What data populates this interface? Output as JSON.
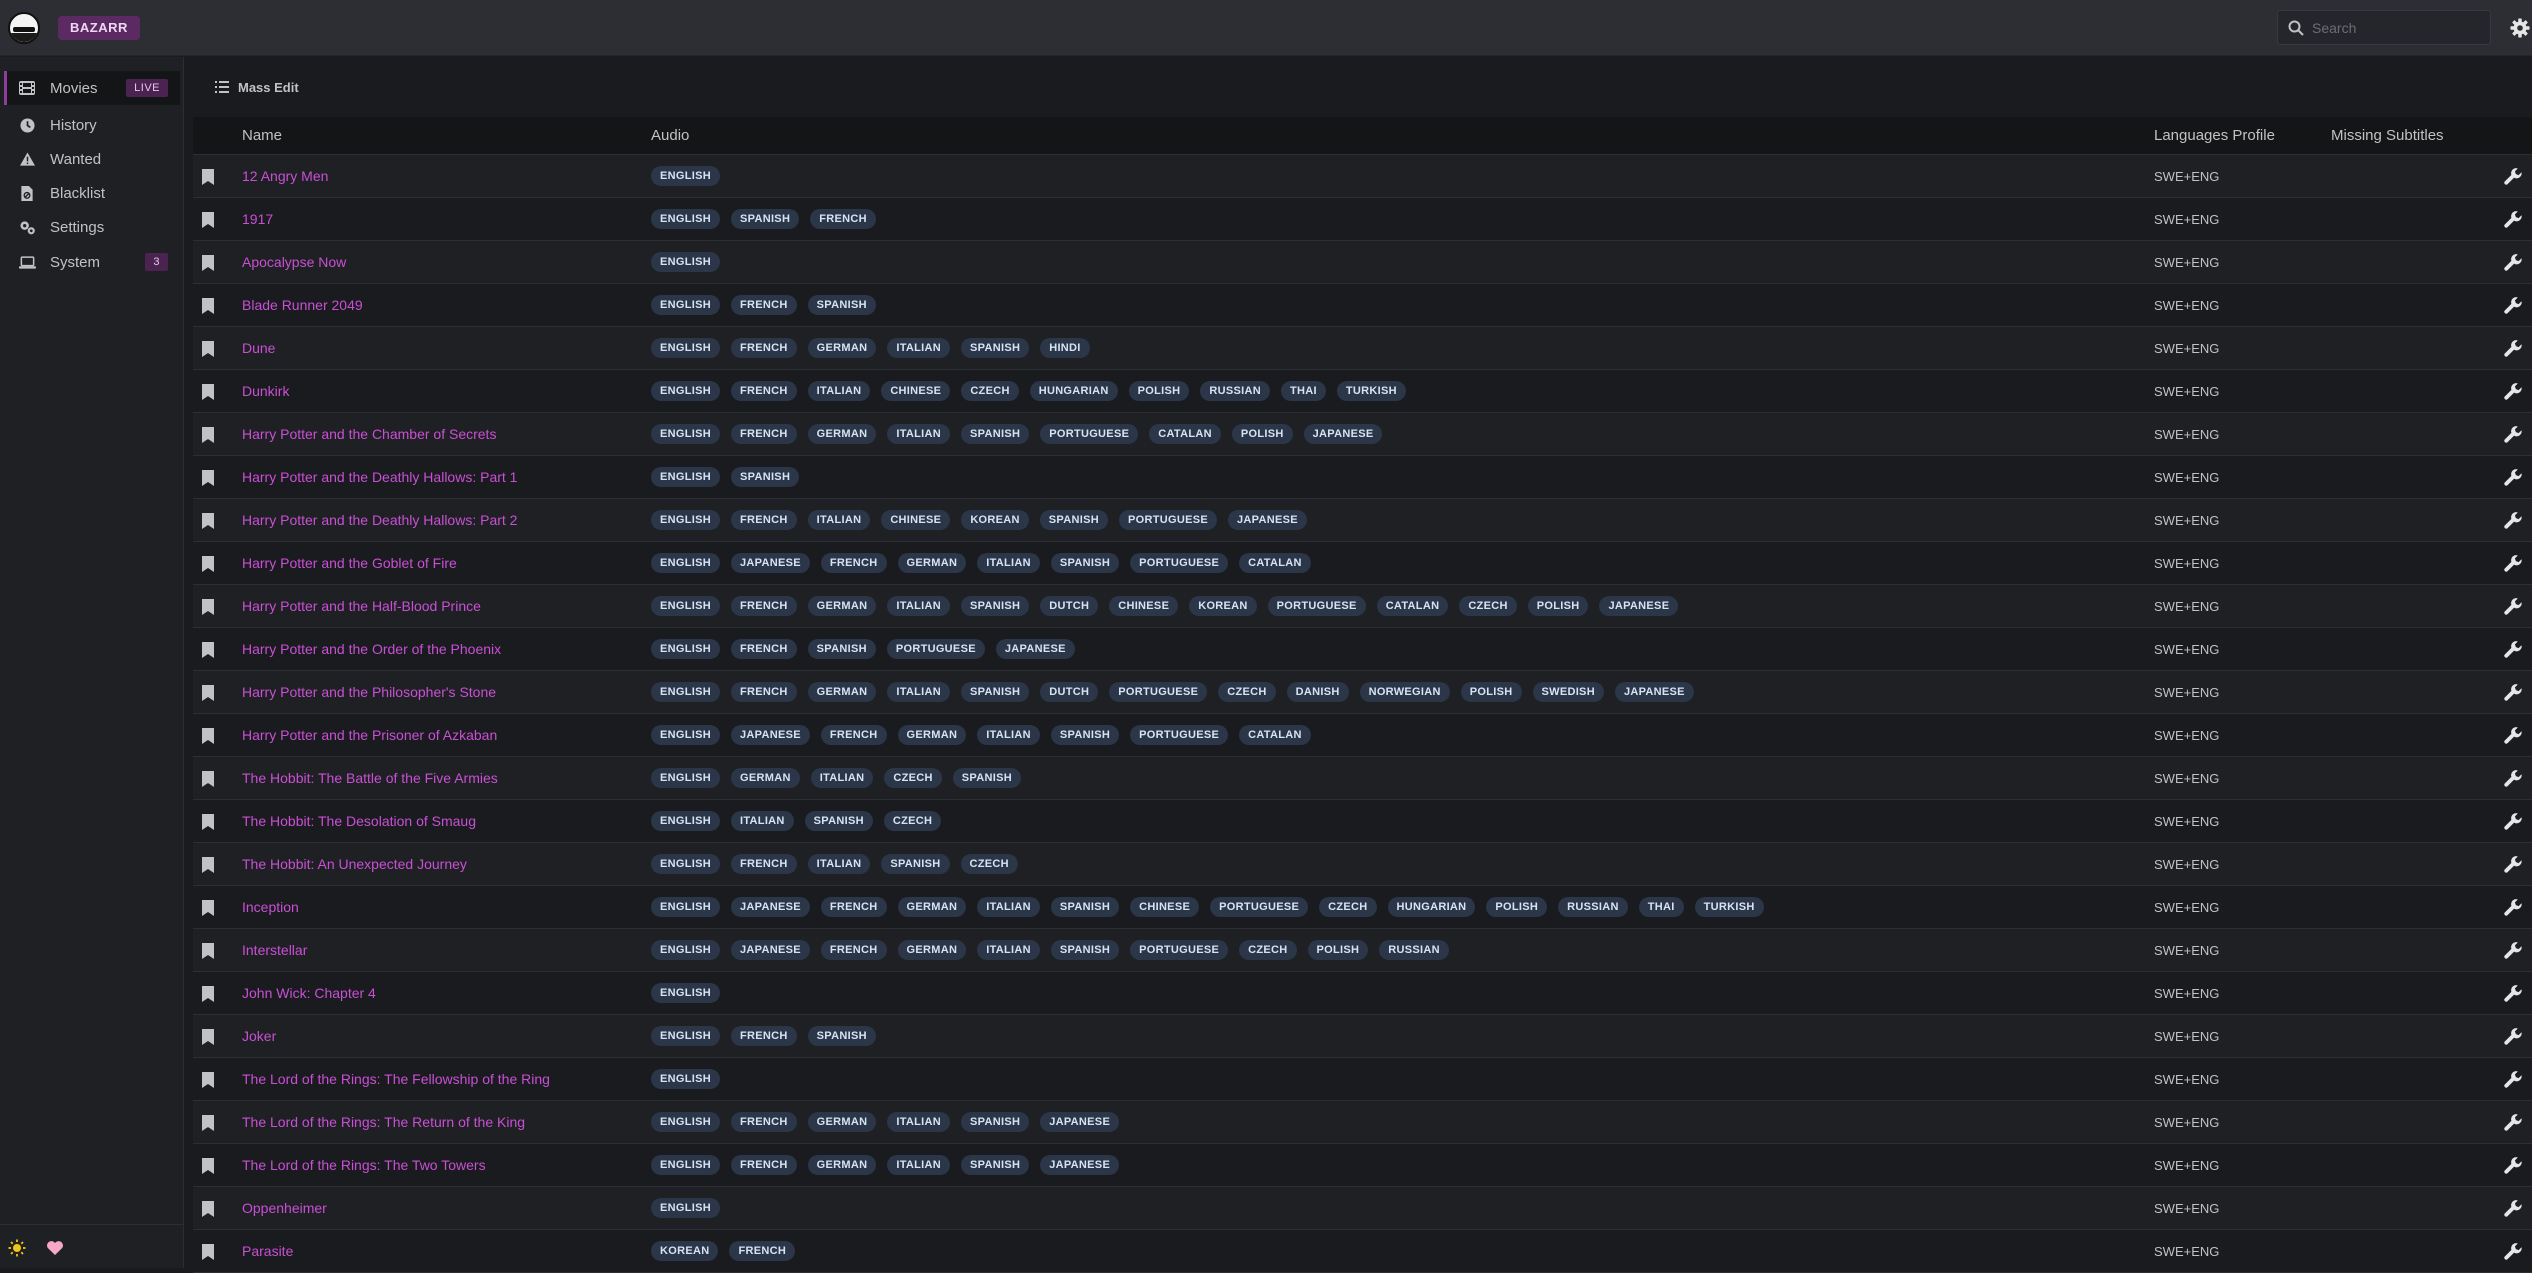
{
  "app": {
    "brand": "BAZARR"
  },
  "search": {
    "placeholder": "Search"
  },
  "sidebar": {
    "items": [
      {
        "label": "Movies",
        "icon": "film-icon",
        "badge": "LIVE",
        "active": true
      },
      {
        "label": "History",
        "icon": "clock-icon",
        "badge": ""
      },
      {
        "label": "Wanted",
        "icon": "warning-icon",
        "badge": ""
      },
      {
        "label": "Blacklist",
        "icon": "file-ban-icon",
        "badge": ""
      },
      {
        "label": "Settings",
        "icon": "cogs-icon",
        "badge": ""
      },
      {
        "label": "System",
        "icon": "laptop-icon",
        "badge": "3"
      }
    ]
  },
  "toolbar": {
    "mass_edit": "Mass Edit"
  },
  "table": {
    "columns": {
      "name": "Name",
      "audio": "Audio",
      "profile": "Languages Profile",
      "missing": "Missing Subtitles"
    },
    "rows": [
      {
        "name": "12 Angry Men",
        "audio": [
          "ENGLISH"
        ],
        "profile": "SWE+ENG"
      },
      {
        "name": "1917",
        "audio": [
          "ENGLISH",
          "SPANISH",
          "FRENCH"
        ],
        "profile": "SWE+ENG"
      },
      {
        "name": "Apocalypse Now",
        "audio": [
          "ENGLISH"
        ],
        "profile": "SWE+ENG"
      },
      {
        "name": "Blade Runner 2049",
        "audio": [
          "ENGLISH",
          "FRENCH",
          "SPANISH"
        ],
        "profile": "SWE+ENG"
      },
      {
        "name": "Dune",
        "audio": [
          "ENGLISH",
          "FRENCH",
          "GERMAN",
          "ITALIAN",
          "SPANISH",
          "HINDI"
        ],
        "profile": "SWE+ENG"
      },
      {
        "name": "Dunkirk",
        "audio": [
          "ENGLISH",
          "FRENCH",
          "ITALIAN",
          "CHINESE",
          "CZECH",
          "HUNGARIAN",
          "POLISH",
          "RUSSIAN",
          "THAI",
          "TURKISH"
        ],
        "profile": "SWE+ENG"
      },
      {
        "name": "Harry Potter and the Chamber of Secrets",
        "audio": [
          "ENGLISH",
          "FRENCH",
          "GERMAN",
          "ITALIAN",
          "SPANISH",
          "PORTUGUESE",
          "CATALAN",
          "POLISH",
          "JAPANESE"
        ],
        "profile": "SWE+ENG"
      },
      {
        "name": "Harry Potter and the Deathly Hallows: Part 1",
        "audio": [
          "ENGLISH",
          "SPANISH"
        ],
        "profile": "SWE+ENG"
      },
      {
        "name": "Harry Potter and the Deathly Hallows: Part 2",
        "audio": [
          "ENGLISH",
          "FRENCH",
          "ITALIAN",
          "CHINESE",
          "KOREAN",
          "SPANISH",
          "PORTUGUESE",
          "JAPANESE"
        ],
        "profile": "SWE+ENG"
      },
      {
        "name": "Harry Potter and the Goblet of Fire",
        "audio": [
          "ENGLISH",
          "JAPANESE",
          "FRENCH",
          "GERMAN",
          "ITALIAN",
          "SPANISH",
          "PORTUGUESE",
          "CATALAN"
        ],
        "profile": "SWE+ENG"
      },
      {
        "name": "Harry Potter and the Half-Blood Prince",
        "audio": [
          "ENGLISH",
          "FRENCH",
          "GERMAN",
          "ITALIAN",
          "SPANISH",
          "DUTCH",
          "CHINESE",
          "KOREAN",
          "PORTUGUESE",
          "CATALAN",
          "CZECH",
          "POLISH",
          "JAPANESE"
        ],
        "profile": "SWE+ENG"
      },
      {
        "name": "Harry Potter and the Order of the Phoenix",
        "audio": [
          "ENGLISH",
          "FRENCH",
          "SPANISH",
          "PORTUGUESE",
          "JAPANESE"
        ],
        "profile": "SWE+ENG"
      },
      {
        "name": "Harry Potter and the Philosopher's Stone",
        "audio": [
          "ENGLISH",
          "FRENCH",
          "GERMAN",
          "ITALIAN",
          "SPANISH",
          "DUTCH",
          "PORTUGUESE",
          "CZECH",
          "DANISH",
          "NORWEGIAN",
          "POLISH",
          "SWEDISH",
          "JAPANESE"
        ],
        "profile": "SWE+ENG"
      },
      {
        "name": "Harry Potter and the Prisoner of Azkaban",
        "audio": [
          "ENGLISH",
          "JAPANESE",
          "FRENCH",
          "GERMAN",
          "ITALIAN",
          "SPANISH",
          "PORTUGUESE",
          "CATALAN"
        ],
        "profile": "SWE+ENG"
      },
      {
        "name": "The Hobbit: The Battle of the Five Armies",
        "audio": [
          "ENGLISH",
          "GERMAN",
          "ITALIAN",
          "CZECH",
          "SPANISH"
        ],
        "profile": "SWE+ENG"
      },
      {
        "name": "The Hobbit: The Desolation of Smaug",
        "audio": [
          "ENGLISH",
          "ITALIAN",
          "SPANISH",
          "CZECH"
        ],
        "profile": "SWE+ENG"
      },
      {
        "name": "The Hobbit: An Unexpected Journey",
        "audio": [
          "ENGLISH",
          "FRENCH",
          "ITALIAN",
          "SPANISH",
          "CZECH"
        ],
        "profile": "SWE+ENG"
      },
      {
        "name": "Inception",
        "audio": [
          "ENGLISH",
          "JAPANESE",
          "FRENCH",
          "GERMAN",
          "ITALIAN",
          "SPANISH",
          "CHINESE",
          "PORTUGUESE",
          "CZECH",
          "HUNGARIAN",
          "POLISH",
          "RUSSIAN",
          "THAI",
          "TURKISH"
        ],
        "profile": "SWE+ENG"
      },
      {
        "name": "Interstellar",
        "audio": [
          "ENGLISH",
          "JAPANESE",
          "FRENCH",
          "GERMAN",
          "ITALIAN",
          "SPANISH",
          "PORTUGUESE",
          "CZECH",
          "POLISH",
          "RUSSIAN"
        ],
        "profile": "SWE+ENG"
      },
      {
        "name": "John Wick: Chapter 4",
        "audio": [
          "ENGLISH"
        ],
        "profile": "SWE+ENG"
      },
      {
        "name": "Joker",
        "audio": [
          "ENGLISH",
          "FRENCH",
          "SPANISH"
        ],
        "profile": "SWE+ENG"
      },
      {
        "name": "The Lord of the Rings: The Fellowship of the Ring",
        "audio": [
          "ENGLISH"
        ],
        "profile": "SWE+ENG"
      },
      {
        "name": "The Lord of the Rings: The Return of the King",
        "audio": [
          "ENGLISH",
          "FRENCH",
          "GERMAN",
          "ITALIAN",
          "SPANISH",
          "JAPANESE"
        ],
        "profile": "SWE+ENG"
      },
      {
        "name": "The Lord of the Rings: The Two Towers",
        "audio": [
          "ENGLISH",
          "FRENCH",
          "GERMAN",
          "ITALIAN",
          "SPANISH",
          "JAPANESE"
        ],
        "profile": "SWE+ENG"
      },
      {
        "name": "Oppenheimer",
        "audio": [
          "ENGLISH"
        ],
        "profile": "SWE+ENG"
      },
      {
        "name": "Parasite",
        "audio": [
          "KOREAN",
          "FRENCH"
        ],
        "profile": "SWE+ENG"
      }
    ]
  },
  "colors": {
    "accent": "#c94fd6",
    "brand_bg": "#5c2a62",
    "tag_bg": "#2b3648"
  }
}
